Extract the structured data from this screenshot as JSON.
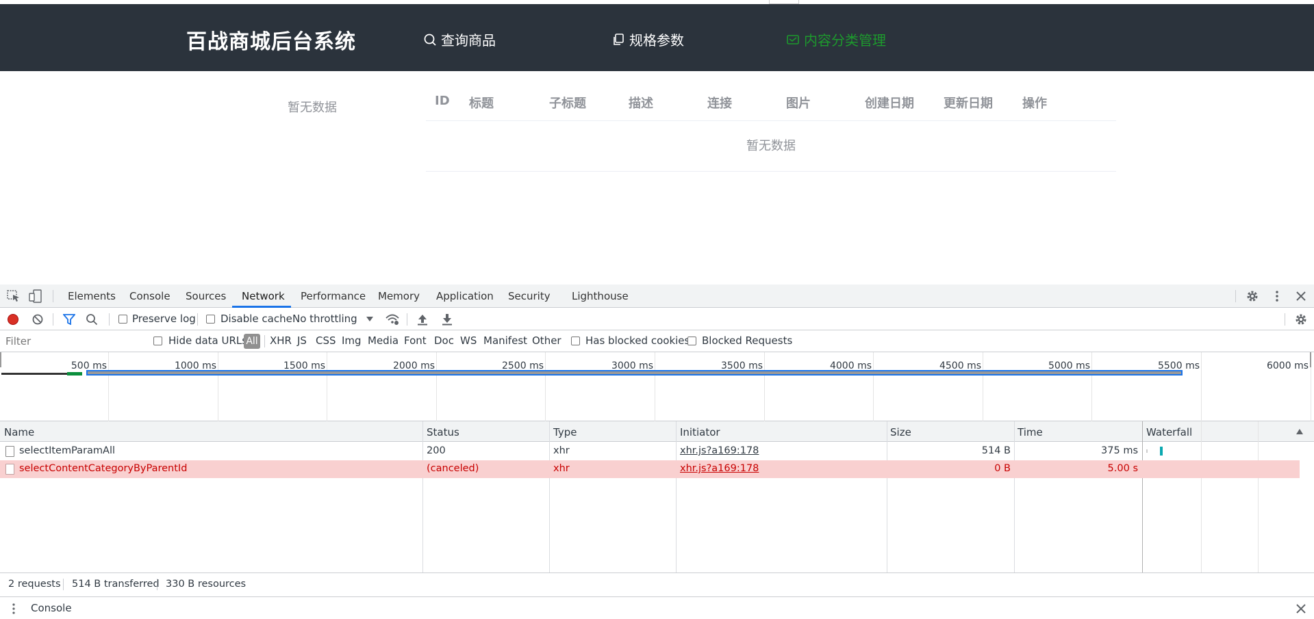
{
  "app": {
    "brand": "百战商城后台系统",
    "nav": [
      {
        "label": "查询商品",
        "icon": "search-icon",
        "active": false
      },
      {
        "label": "规格参数",
        "icon": "copy-icon",
        "active": false
      },
      {
        "label": "内容分类管理",
        "icon": "message-icon",
        "active": true
      }
    ],
    "colors": {
      "header_bg": "#2b333c",
      "active_nav": "#1d9a2d"
    },
    "sidebar_empty": "暂无数据",
    "table": {
      "headers": [
        "ID",
        "标题",
        "子标题",
        "描述",
        "连接",
        "图片",
        "创建日期",
        "更新日期",
        "操作"
      ],
      "empty_text": "暂无数据"
    }
  },
  "devtools": {
    "tabs": [
      "Elements",
      "Console",
      "Sources",
      "Network",
      "Performance",
      "Memory",
      "Application",
      "Security",
      "Lighthouse"
    ],
    "active_tab": "Network",
    "toolbar": {
      "preserve_log": "Preserve log",
      "disable_cache": "Disable cache",
      "throttling": "No throttling"
    },
    "filter": {
      "placeholder": "Filter",
      "hide_data_urls": "Hide data URLs",
      "types": [
        "All",
        "XHR",
        "JS",
        "CSS",
        "Img",
        "Media",
        "Font",
        "Doc",
        "WS",
        "Manifest",
        "Other"
      ],
      "has_blocked_cookies": "Has blocked cookies",
      "blocked_requests": "Blocked Requests"
    },
    "overview_ticks": [
      "500 ms",
      "1000 ms",
      "1500 ms",
      "2000 ms",
      "2500 ms",
      "3000 ms",
      "3500 ms",
      "4000 ms",
      "4500 ms",
      "5000 ms",
      "5500 ms",
      "6000 ms"
    ],
    "columns": [
      "Name",
      "Status",
      "Type",
      "Initiator",
      "Size",
      "Time",
      "Waterfall"
    ],
    "requests": [
      {
        "name": "selectItemParamAll",
        "status": "200",
        "type": "xhr",
        "initiator": "xhr.js?a169:178",
        "size": "514 B",
        "time": "375 ms",
        "error": false
      },
      {
        "name": "selectContentCategoryByParentId",
        "status": "(canceled)",
        "type": "xhr",
        "initiator": "xhr.js?a169:178",
        "size": "0 B",
        "time": "5.00 s",
        "error": true
      }
    ],
    "summary": {
      "requests": "2 requests",
      "transferred": "514 B transferred",
      "resources": "330 B resources"
    },
    "drawer": {
      "title": "Console"
    }
  }
}
